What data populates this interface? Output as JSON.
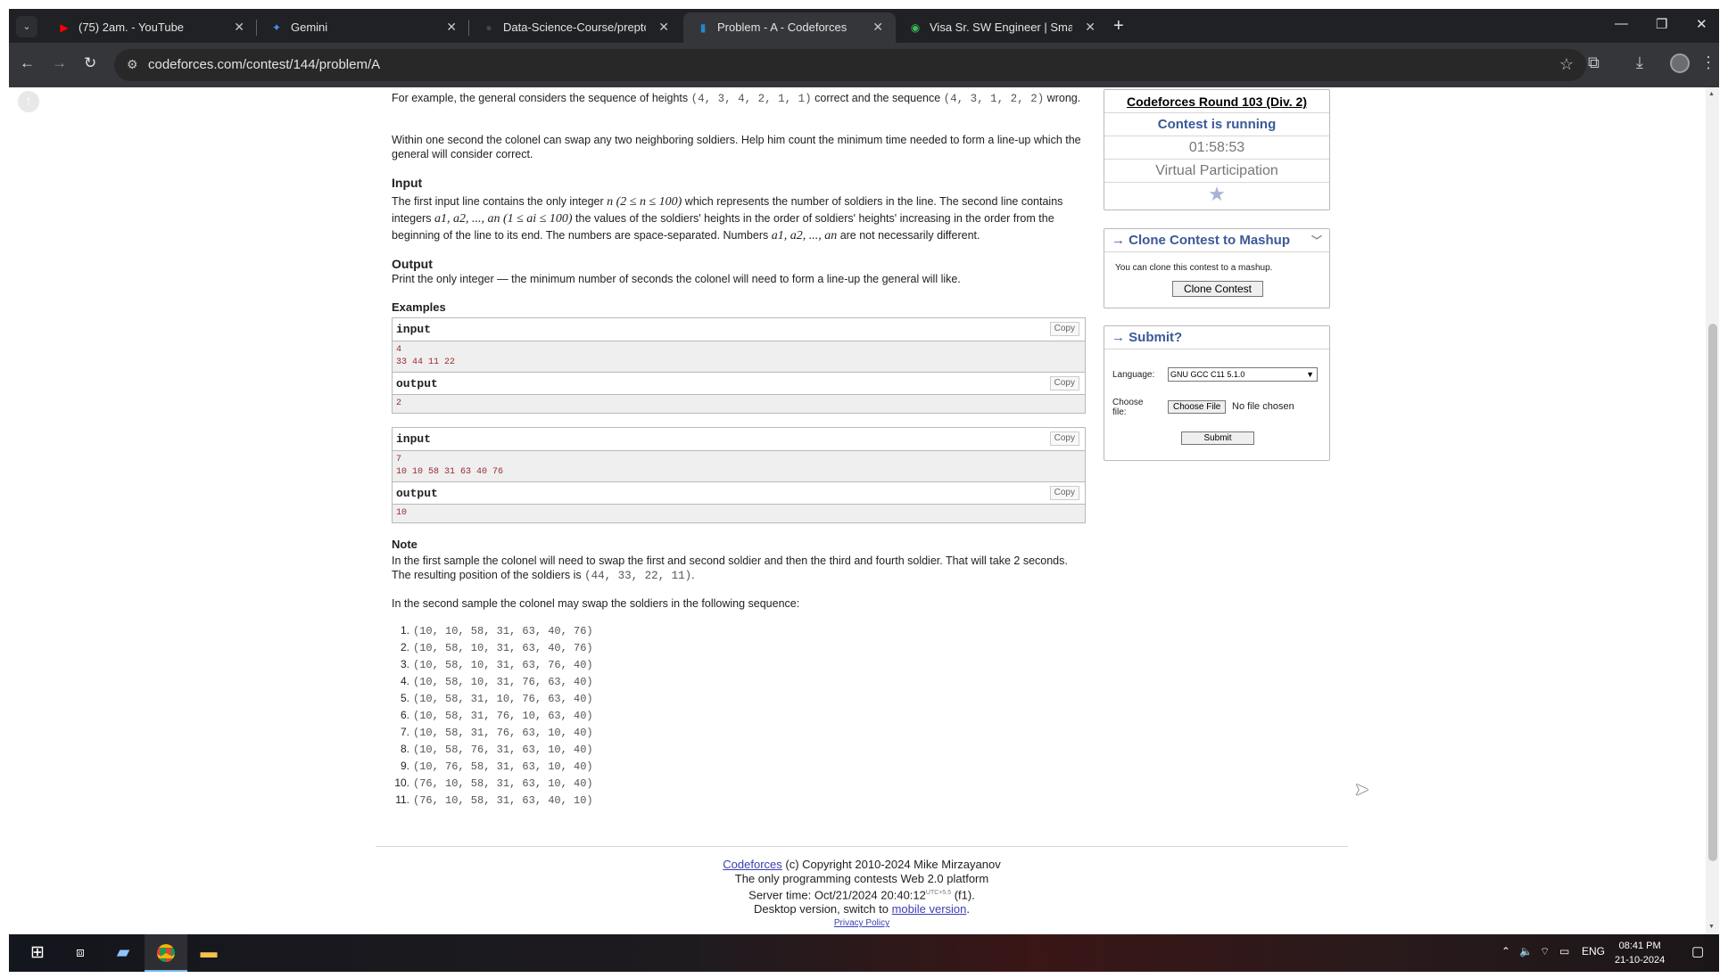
{
  "browser": {
    "tabs": [
      {
        "label": "(75) 2am. - YouTube",
        "icon": "youtube-icon",
        "icon_color": "#ff0000"
      },
      {
        "label": "Gemini",
        "icon": "gemini-icon",
        "icon_color": "#4c8df6"
      },
      {
        "label": "Data-Science-Course/preptopic",
        "icon": "github-icon",
        "icon_color": "#1b1f23"
      },
      {
        "label": "Problem - A - Codeforces",
        "icon": "codeforces-icon",
        "icon_color": "#1f8acb"
      },
      {
        "label": "Visa Sr. SW Engineer | SmartRec",
        "icon": "smartrecruiters-icon",
        "icon_color": "#3cba54"
      }
    ],
    "active_tab_index": 3,
    "url": "codeforces.com/contest/144/problem/A"
  },
  "problem": {
    "para_example_1": "For example, the general considers the sequence of heights ",
    "correct_seq": "(4, 3, 4, 2, 1, 1)",
    "para_example_2": " correct and the sequence ",
    "wrong_seq": "(4, 3, 1, 2, 2)",
    "para_example_3": " wrong.",
    "para_swap": "Within one second the colonel can swap any two neighboring soldiers. Help him count the minimum time needed to form a line-up which the general will consider correct.",
    "input_title": "Input",
    "input_text_1": "The first input line contains the only integer ",
    "input_n": "n (2 ≤ n ≤ 100)",
    "input_text_2": " which represents the number of soldiers in the line. The second line contains integers ",
    "input_a": "a1, a2, ..., an (1 ≤ ai ≤ 100)",
    "input_text_3": " the values of the soldiers' heights in the order of soldiers' heights' increasing in the order from the beginning of the line to its end. The numbers are space-separated. Numbers ",
    "input_a2": "a1, a2, ..., an",
    "input_text_4": " are not necessarily different.",
    "output_title": "Output",
    "output_text": "Print the only integer — the minimum number of seconds the colonel will need to form a line-up the general will like.",
    "examples_title": "Examples",
    "input_label": "input",
    "output_label": "output",
    "copy_label": "Copy",
    "samples": [
      {
        "input_line1": "4",
        "input_line2": "33 44 11 22",
        "output": "2"
      },
      {
        "input_line1": "7",
        "input_line2": "10 10 58 31 63 40 76",
        "output": "10"
      }
    ],
    "note_title": "Note",
    "note_text_1": "In the first sample the colonel will need to swap the first and second soldier and then the third and fourth soldier. That will take 2 seconds. The resulting position of the soldiers is ",
    "note_result": "(44, 33, 22, 11)",
    "note_text_2": ".",
    "note_text_3": "In the second sample the colonel may swap the soldiers in the following sequence:",
    "sequence": [
      "(10, 10, 58, 31, 63, 40, 76)",
      "(10, 58, 10, 31, 63, 40, 76)",
      "(10, 58, 10, 31, 63, 76, 40)",
      "(10, 58, 10, 31, 76, 63, 40)",
      "(10, 58, 31, 10, 76, 63, 40)",
      "(10, 58, 31, 76, 10, 63, 40)",
      "(10, 58, 31, 76, 63, 10, 40)",
      "(10, 58, 76, 31, 63, 10, 40)",
      "(10, 76, 58, 31, 63, 10, 40)",
      "(76, 10, 58, 31, 63, 10, 40)",
      "(76, 10, 58, 31, 63, 40, 10)"
    ]
  },
  "sidebar": {
    "round_name": "Codeforces Round 103 (Div. 2)",
    "status": "Contest is running",
    "timer": "01:58:53",
    "participation": "Virtual Participation",
    "clone_title": "→ Clone Contest to Mashup",
    "clone_text": "You can clone this contest to a mashup.",
    "clone_button": "Clone Contest",
    "submit_title": "→ Submit?",
    "language_label": "Language:",
    "language_value": "GNU GCC C11 5.1.0",
    "file_label": "Choose file:",
    "file_button": "Choose File",
    "file_status": "No file chosen",
    "submit_button": "Submit"
  },
  "footer": {
    "codeforces_link": "Codeforces",
    "copyright": " (c) Copyright 2010-2024 Mike Mirzayanov",
    "tagline": "The only programming contests Web 2.0 platform",
    "server_time_prefix": "Server time: Oct/21/2024 20:40:12",
    "server_time_tz": "UTC+5.5",
    "server_time_suffix": " (f1).",
    "desktop_prefix": "Desktop version, switch to ",
    "mobile_link": "mobile version",
    "desktop_suffix": ".",
    "privacy": "Privacy Policy"
  },
  "taskbar": {
    "language": "ENG",
    "time": "08:41 PM",
    "date": "21-10-2024"
  }
}
